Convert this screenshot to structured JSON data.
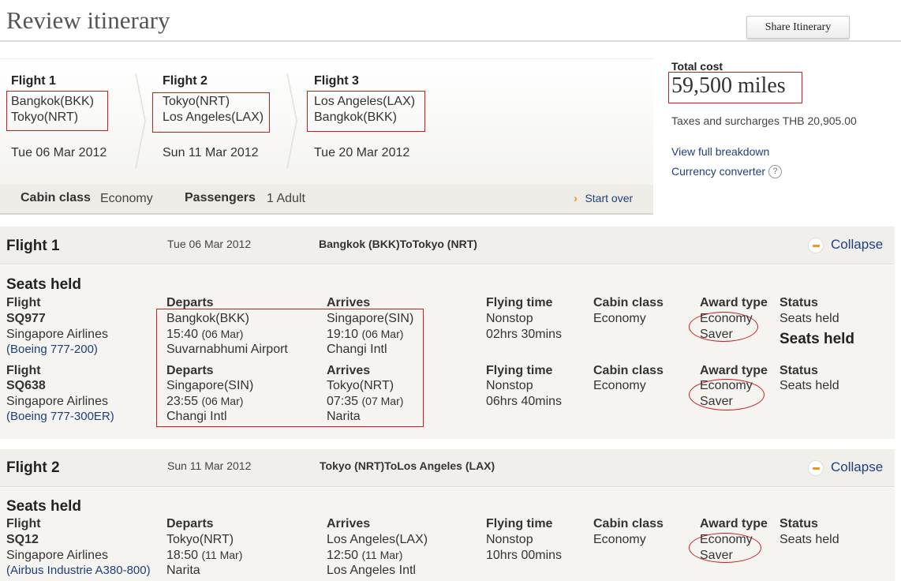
{
  "page": {
    "title": "Review itinerary",
    "share_label": "Share Itinerary"
  },
  "summary": {
    "flights": [
      {
        "heading": "Flight 1",
        "from": "Bangkok(BKK)",
        "to": "Tokyo(NRT)",
        "date": "Tue 06 Mar 2012"
      },
      {
        "heading": "Flight 2",
        "from": "Tokyo(NRT)",
        "to": "Los Angeles(LAX)",
        "date": "Sun 11 Mar 2012"
      },
      {
        "heading": "Flight 3",
        "from": "Los Angeles(LAX)",
        "to": "Bangkok(BKK)",
        "date": "Tue 20 Mar 2012"
      }
    ],
    "cabin_label": "Cabin class",
    "cabin_value": "Economy",
    "passengers_label": "Passengers",
    "passengers_value": "1 Adult",
    "start_over": "Start over"
  },
  "cost": {
    "label": "Total cost",
    "value": "59,500 miles",
    "taxes": "Taxes and surcharges THB 20,905.00",
    "breakdown_link": "View full breakdown",
    "converter_link": "Currency converter",
    "help_glyph": "?"
  },
  "columns": {
    "flight": "Flight",
    "departs": "Departs",
    "arrives": "Arrives",
    "flying_time": "Flying time",
    "cabin_class": "Cabin class",
    "award_type": "Award type",
    "status": "Status"
  },
  "sections": [
    {
      "title": "Flight 1",
      "date": "Tue 06 Mar 2012",
      "route": "Bangkok (BKK)ToTokyo (NRT)",
      "collapse": "Collapse",
      "seats_heading": "Seats held",
      "segments": [
        {
          "flight_no": "SQ977",
          "airline": "Singapore Airlines",
          "aircraft": "(Boeing 777-200)",
          "dep_city": "Bangkok(BKK)",
          "dep_time": "15:40",
          "dep_date": "(06 Mar)",
          "dep_airport": "Suvarnabhumi Airport",
          "arr_city": "Singapore(SIN)",
          "arr_time": "19:10",
          "arr_date": "(06 Mar)",
          "arr_airport": "Changi Intl",
          "stops": "Nonstop",
          "duration": "02hrs 30mins",
          "cabin": "Economy",
          "award_1": "Economy",
          "award_2": "Saver",
          "status": "Seats held",
          "status_note": "Seats held"
        },
        {
          "flight_no": "SQ638",
          "airline": "Singapore Airlines",
          "aircraft": "(Boeing 777-300ER)",
          "dep_city": "Singapore(SIN)",
          "dep_time": "23:55",
          "dep_date": "(06 Mar)",
          "dep_airport": "Changi Intl",
          "arr_city": "Tokyo(NRT)",
          "arr_time": "07:35",
          "arr_date": "(07 Mar)",
          "arr_airport": "Narita",
          "stops": "Nonstop",
          "duration": "06hrs 40mins",
          "cabin": "Economy",
          "award_1": "Economy",
          "award_2": "Saver",
          "status": "Seats held"
        }
      ]
    },
    {
      "title": "Flight 2",
      "date": "Sun 11 Mar 2012",
      "route": "Tokyo (NRT)ToLos Angeles (LAX)",
      "collapse": "Collapse",
      "seats_heading": "Seats held",
      "segments": [
        {
          "flight_no": "SQ12",
          "airline": "Singapore Airlines",
          "aircraft": "(Airbus Industrie A380-800)",
          "dep_city": "Tokyo(NRT)",
          "dep_time": "18:50",
          "dep_date": "(11 Mar)",
          "dep_airport": "Narita",
          "arr_city": "Los Angeles(LAX)",
          "arr_time": "12:50",
          "arr_date": "(11 Mar)",
          "arr_airport": "Los Angeles Intl",
          "stops": "Nonstop",
          "duration": "10hrs 00mins",
          "cabin": "Economy",
          "award_1": "Economy",
          "award_2": "Saver",
          "status": "Seats held"
        }
      ]
    }
  ],
  "colors": {
    "link": "#1d3f7e",
    "accent": "#f0961e",
    "annotation": "#d21a1a"
  }
}
